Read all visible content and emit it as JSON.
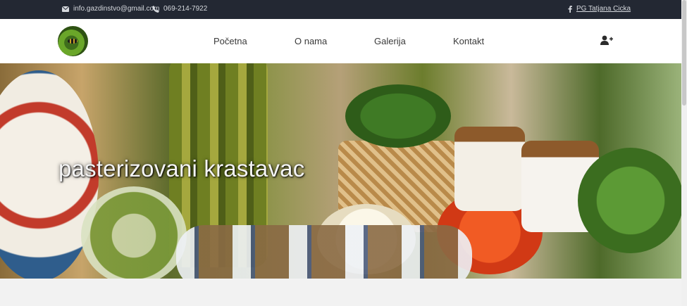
{
  "topbar": {
    "email": "info.gazdinstvo@gmail.com",
    "phone": "069-214-7922",
    "facebook": "PG Tatjana Cicka",
    "icons": [
      "envelope-icon",
      "phone-icon",
      "facebook-icon"
    ]
  },
  "nav": {
    "items": [
      "Početna",
      "O nama",
      "Galerija",
      "Kontakt"
    ],
    "user_icon": "user-plus-icon"
  },
  "hero": {
    "title": "pasterizovani krastavac"
  },
  "colors": {
    "topbar_bg": "#232833",
    "navbar_bg": "#ffffff",
    "page_bg": "#f2f2f2"
  }
}
